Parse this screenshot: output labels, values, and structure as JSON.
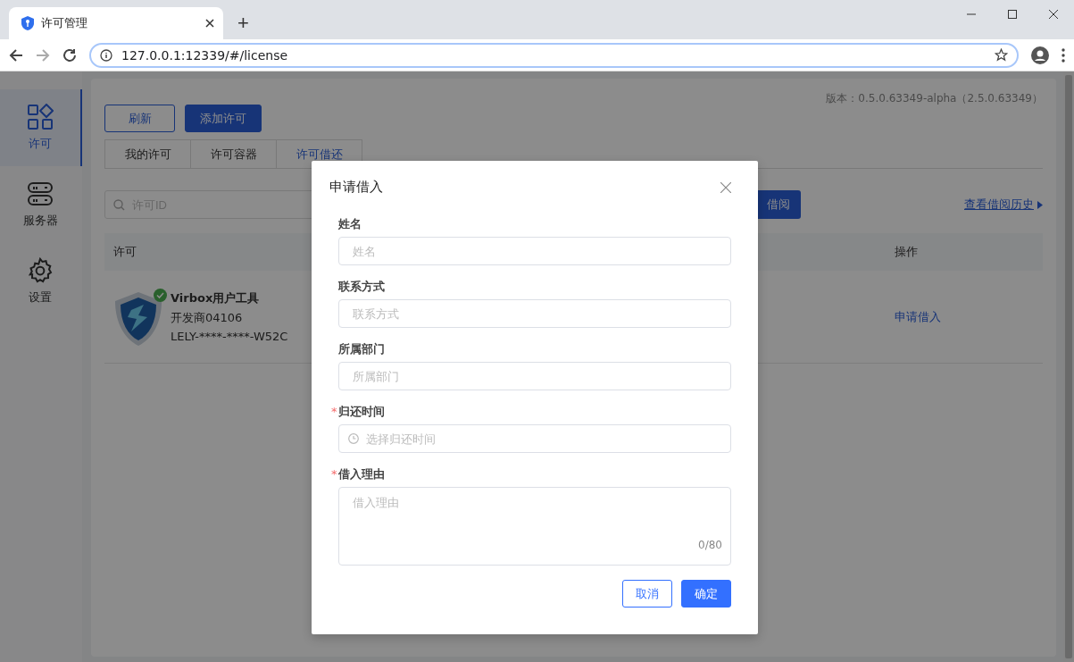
{
  "browser": {
    "tab_title": "许可管理",
    "new_tab": "+",
    "address": "127.0.0.1:12339/#/license"
  },
  "sidebar": {
    "items": [
      {
        "label": "许可",
        "selected": true
      },
      {
        "label": "服务器",
        "selected": false
      },
      {
        "label": "设置",
        "selected": false
      }
    ]
  },
  "toolbar": {
    "buttons": [
      {
        "label": "刷新",
        "kind": "outline"
      },
      {
        "label": "添加许可",
        "kind": "primary"
      }
    ],
    "version": "版本：0.5.0.63349-alpha（2.5.0.63349）"
  },
  "tabs": [
    {
      "label": "我的许可",
      "selected": false
    },
    {
      "label": "许可容器",
      "selected": false
    },
    {
      "label": "许可借还",
      "selected": true
    }
  ],
  "filter": {
    "search_placeholder": "许可ID",
    "action_button": "借阅",
    "history_link": "查看借阅历史"
  },
  "table": {
    "columns": [
      "许可",
      "操作"
    ],
    "rows": [
      {
        "name": "Virbox用户工具",
        "vendor": "开发商04106",
        "license_id": "LELY-****-****-W52C",
        "verified": true,
        "action": "申请借入"
      }
    ]
  },
  "dialog": {
    "title": "申请借入",
    "required_mark": "*",
    "fields": [
      {
        "label": "姓名",
        "placeholder": "姓名",
        "required": false,
        "kind": "text"
      },
      {
        "label": "联系方式",
        "placeholder": "联系方式",
        "required": false,
        "kind": "text"
      },
      {
        "label": "所属部门",
        "placeholder": "所属部门",
        "required": false,
        "kind": "text"
      },
      {
        "label": "归还时间",
        "placeholder": "选择归还时间",
        "required": true,
        "kind": "time"
      },
      {
        "label": "借入理由",
        "placeholder": "借入理由",
        "required": true,
        "kind": "textarea",
        "counter": "0/80"
      }
    ],
    "buttons": [
      {
        "label": "取消",
        "kind": "outline"
      },
      {
        "label": "确定",
        "kind": "primary"
      }
    ]
  }
}
